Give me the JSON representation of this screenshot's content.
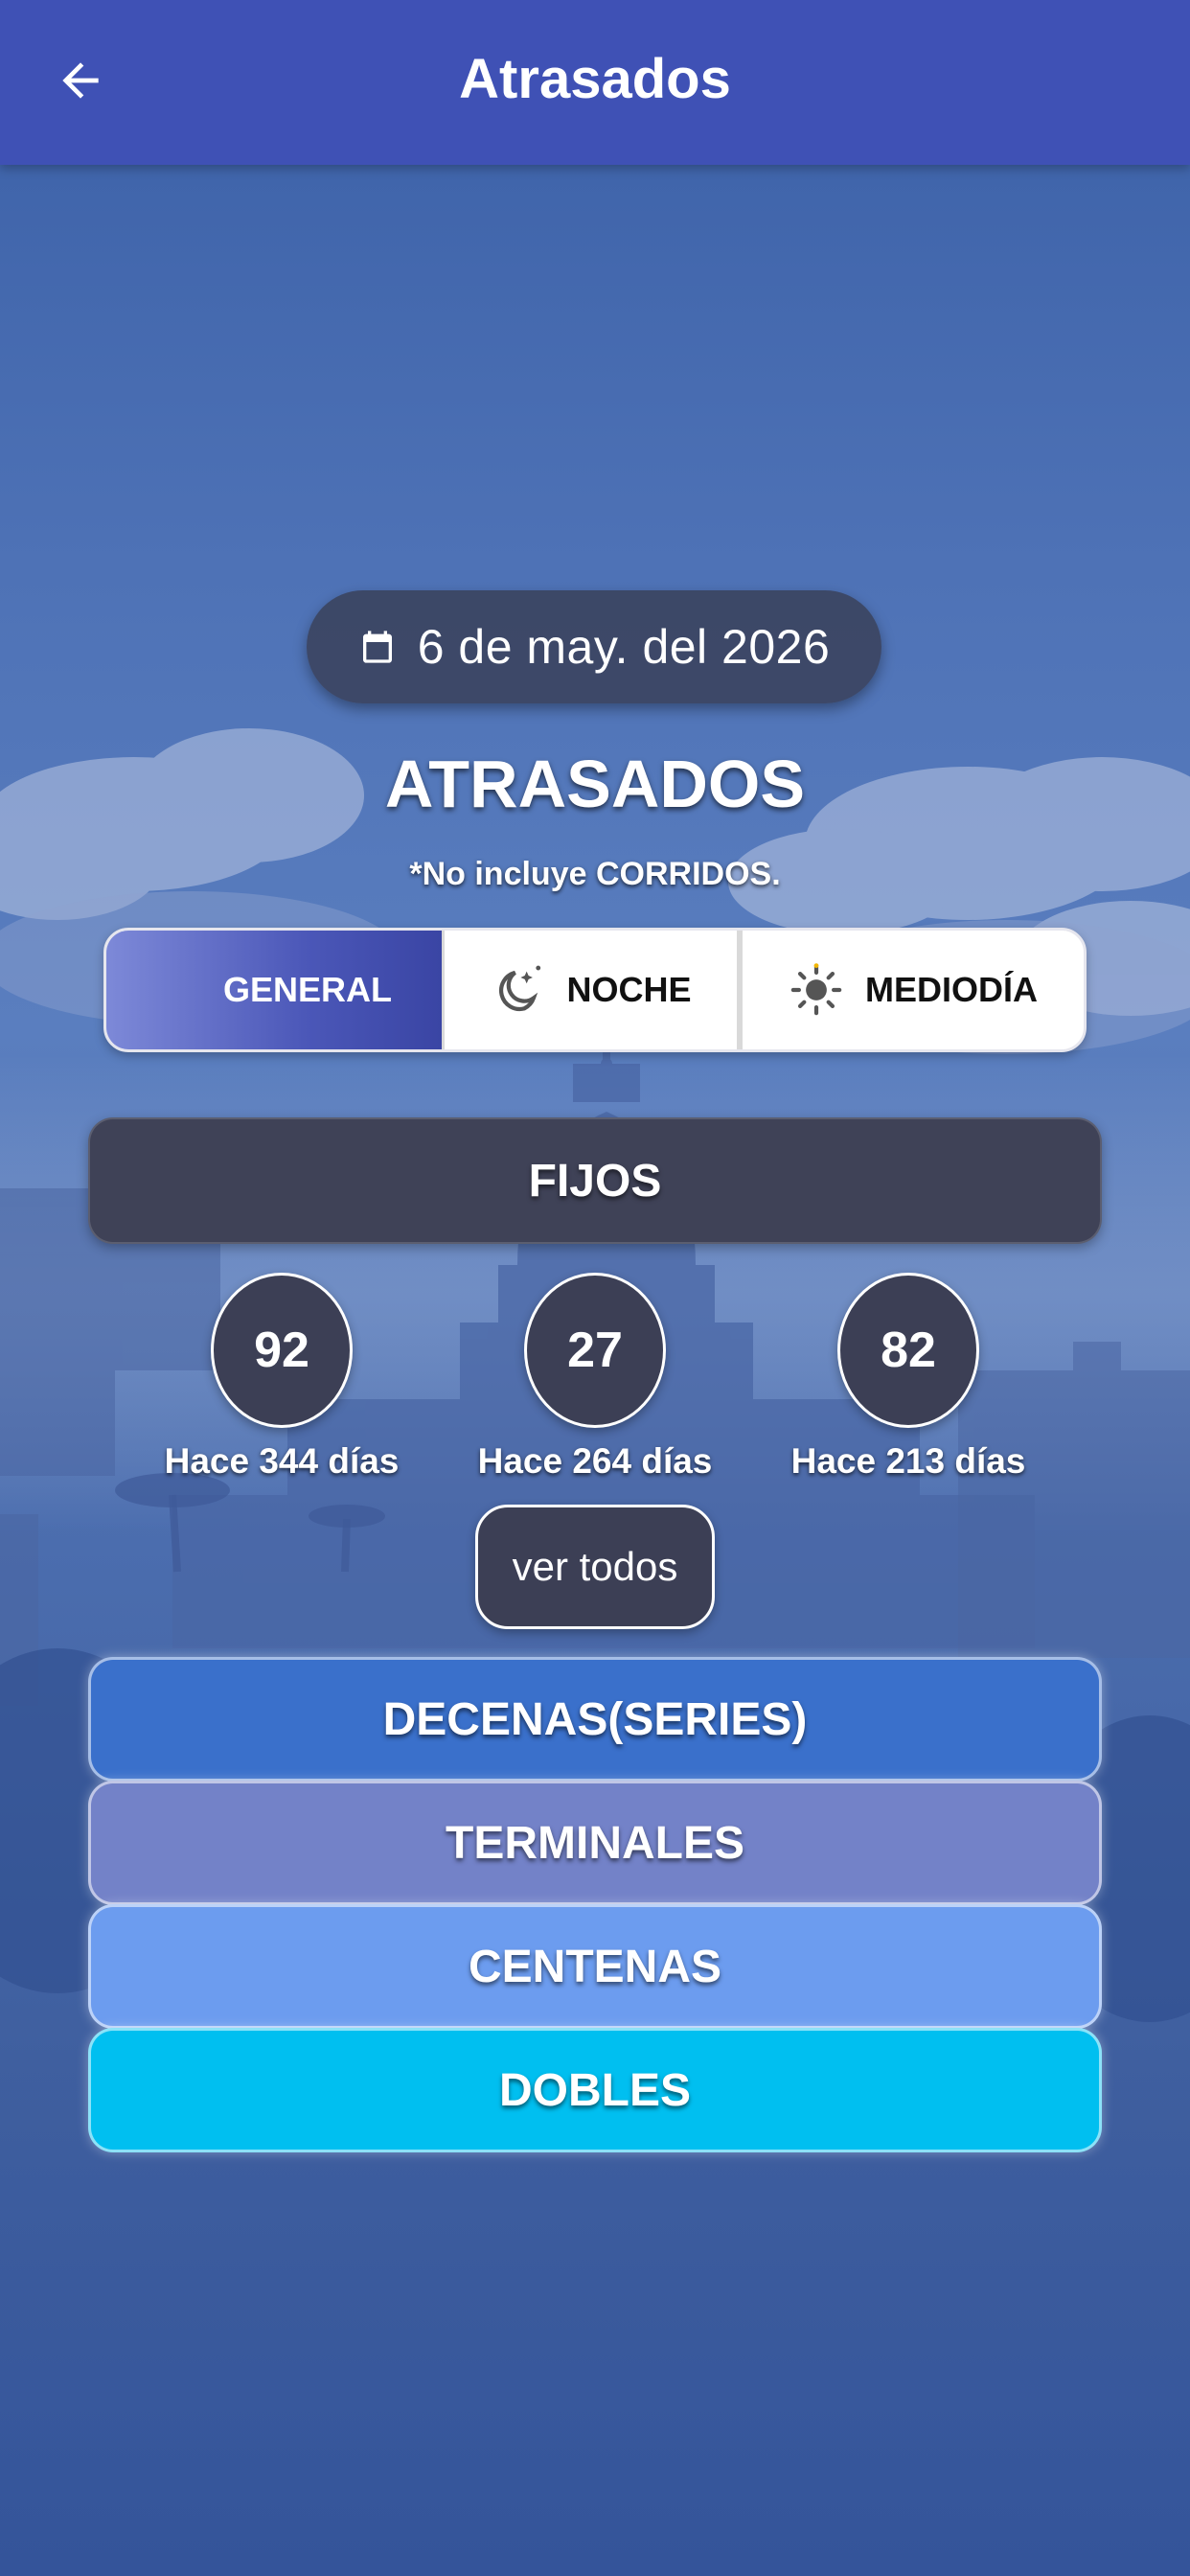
{
  "appbar": {
    "title": "Atrasados",
    "back_icon": "arrow-left-icon",
    "background": "#3f51b5"
  },
  "date": {
    "icon": "calendar-icon",
    "label": "6 de may. del 2026"
  },
  "heading": {
    "title": "ATRASADOS",
    "note": "*No incluye CORRIDOS."
  },
  "segments": {
    "selected": "GENERAL",
    "items": [
      {
        "label": "GENERAL",
        "icon": "",
        "selected": true
      },
      {
        "label": "NOCHE",
        "icon": "moon-stars-icon",
        "selected": false
      },
      {
        "label": "MEDIODÍA",
        "icon": "sun-icon",
        "selected": false
      }
    ]
  },
  "fijos": {
    "label": "FIJOS",
    "numbers": [
      {
        "value": "92",
        "caption": "Hace 344 días"
      },
      {
        "value": "27",
        "caption": "Hace 264 días"
      },
      {
        "value": "82",
        "caption": "Hace 213 días"
      }
    ],
    "more_label": "ver todos"
  },
  "categories": [
    {
      "label": "DECENAS(SERIES)",
      "color": "#3a70cb"
    },
    {
      "label": "TERMINALES",
      "color": "#7382c8"
    },
    {
      "label": "CENTENAS",
      "color": "#6c9cef"
    },
    {
      "label": "DOBLES",
      "color": "#00bff0"
    }
  ]
}
